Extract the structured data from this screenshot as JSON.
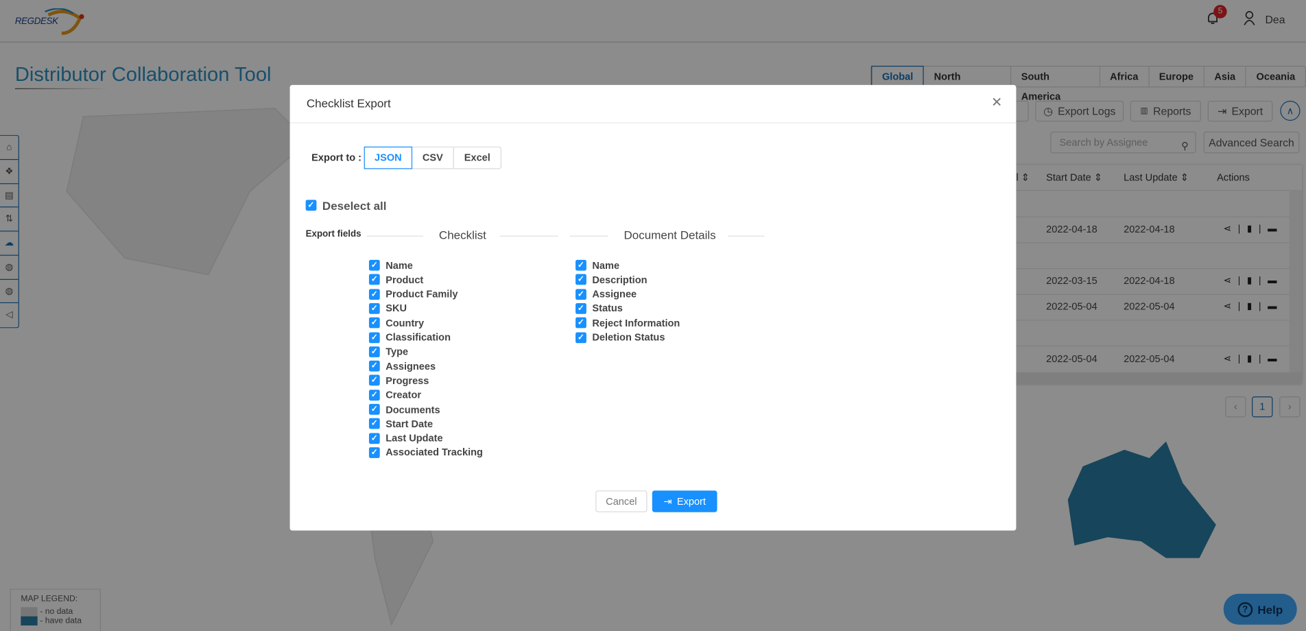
{
  "header": {
    "logo": "REGDESK",
    "notifications": "5",
    "user": "Dea"
  },
  "page": {
    "title": "Distributor Collaboration Tool"
  },
  "regions": [
    "Global",
    "North America",
    "South America",
    "Africa",
    "Europe",
    "Asia",
    "Oceania"
  ],
  "active_region": "Global",
  "toolbar": {
    "export_logs": "Export Logs",
    "reports": "Reports",
    "export": "Export"
  },
  "search": {
    "placeholder": "Search by Assignee",
    "advanced": "Advanced Search"
  },
  "table": {
    "headers": {
      "start_date": "Start Date",
      "last_update": "Last Update",
      "actions": "Actions"
    },
    "rows": [
      {
        "start": "2022-04-18",
        "update": "2022-04-18"
      },
      {
        "start": "2022-03-15",
        "update": "2022-04-18"
      },
      {
        "start": "2022-05-04",
        "update": "2022-05-04"
      },
      {
        "start": "2022-05-04",
        "update": "2022-05-04"
      }
    ]
  },
  "pagination": {
    "current": "1"
  },
  "legend": {
    "title": "MAP LEGEND:",
    "no_data": "- no data",
    "have_data": "- have data",
    "no_data_color": "#d9d9d9",
    "have_data_color": "#2a7ea6"
  },
  "help": "Help",
  "modal": {
    "title": "Checklist Export",
    "export_to_label": "Export to :",
    "formats": [
      "JSON",
      "CSV",
      "Excel"
    ],
    "selected_format": "JSON",
    "deselect_all": "Deselect all",
    "export_fields_label": "Export fields",
    "checklist_title": "Checklist",
    "document_title": "Document Details",
    "checklist_fields": [
      "Name",
      "Product",
      "Product Family",
      "SKU",
      "Country",
      "Classification",
      "Type",
      "Assignees",
      "Progress",
      "Creator",
      "Documents",
      "Start Date",
      "Last Update",
      "Associated Tracking"
    ],
    "document_fields": [
      "Name",
      "Description",
      "Assignee",
      "Status",
      "Reject Information",
      "Deletion Status"
    ],
    "cancel": "Cancel",
    "export": "Export",
    "accent": "#1890ff"
  }
}
